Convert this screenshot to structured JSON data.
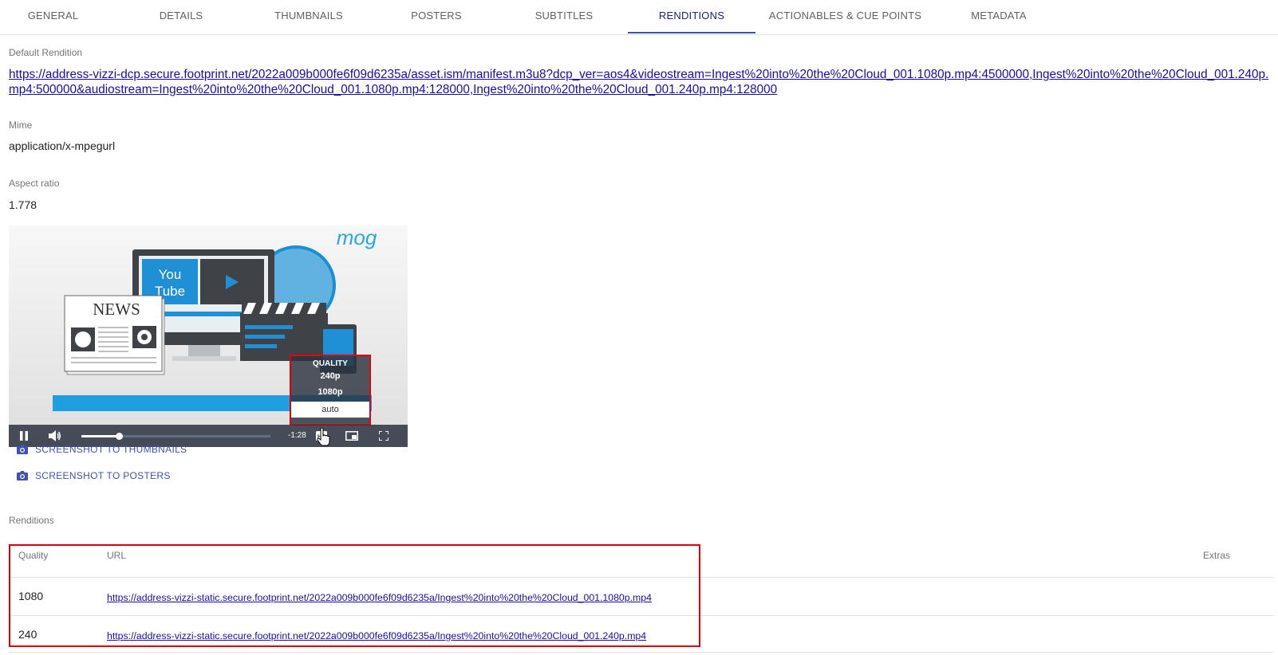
{
  "tabs": [
    {
      "label": "GENERAL"
    },
    {
      "label": "DETAILS"
    },
    {
      "label": "THUMBNAILS"
    },
    {
      "label": "POSTERS"
    },
    {
      "label": "SUBTITLES"
    },
    {
      "label": "RENDITIONS"
    },
    {
      "label": "ACTIONABLES & CUE POINTS"
    },
    {
      "label": "METADATA"
    }
  ],
  "active_tab": "RENDITIONS",
  "default_rendition": {
    "label": "Default Rendition",
    "url": "https://address-vizzi-dcp.secure.footprint.net/2022a009b000fe6f09d6235a/asset.ism/manifest.m3u8?dcp_ver=aos4&videostream=Ingest%20into%20the%20Cloud_001.1080p.mp4:4500000,Ingest%20into%20the%20Cloud_001.240p.mp4:500000&audiostream=Ingest%20into%20the%20Cloud_001.1080p.mp4:128000,Ingest%20into%20the%20Cloud_001.240p.mp4:128000"
  },
  "mime": {
    "label": "Mime",
    "value": "application/x-mpegurl"
  },
  "aspect_ratio": {
    "label": "Aspect ratio",
    "value": "1.778"
  },
  "player": {
    "video_texts": {
      "newspaper_headline": "NEWS",
      "logo": "mog",
      "youtube_top": "You",
      "youtube_bottom": "Tube"
    },
    "time_remaining": "-1:28",
    "progress": 0.2,
    "quality_menu": {
      "title": "QUALITY",
      "options": [
        "240p",
        "1080p",
        "auto"
      ],
      "selected": "auto"
    },
    "hd_badge": "HD"
  },
  "actions": {
    "screenshot_thumbnails": "SCREENSHOT TO THUMBNAILS",
    "screenshot_posters": "SCREENSHOT TO POSTERS"
  },
  "renditions": {
    "label": "Renditions",
    "columns": {
      "quality": "Quality",
      "url": "URL",
      "extras": "Extras"
    },
    "rows": [
      {
        "quality": "1080",
        "url": "https://address-vizzi-static.secure.footprint.net/2022a009b000fe6f09d6235a/Ingest%20into%20the%20Cloud_001.1080p.mp4"
      },
      {
        "quality": "240",
        "url": "https://address-vizzi-static.secure.footprint.net/2022a009b000fe6f09d6235a/Ingest%20into%20the%20Cloud_001.240p.mp4"
      }
    ]
  },
  "colors": {
    "accent": "#3f51b5",
    "link": "#1a0dab",
    "highlight": "#e0000b"
  }
}
